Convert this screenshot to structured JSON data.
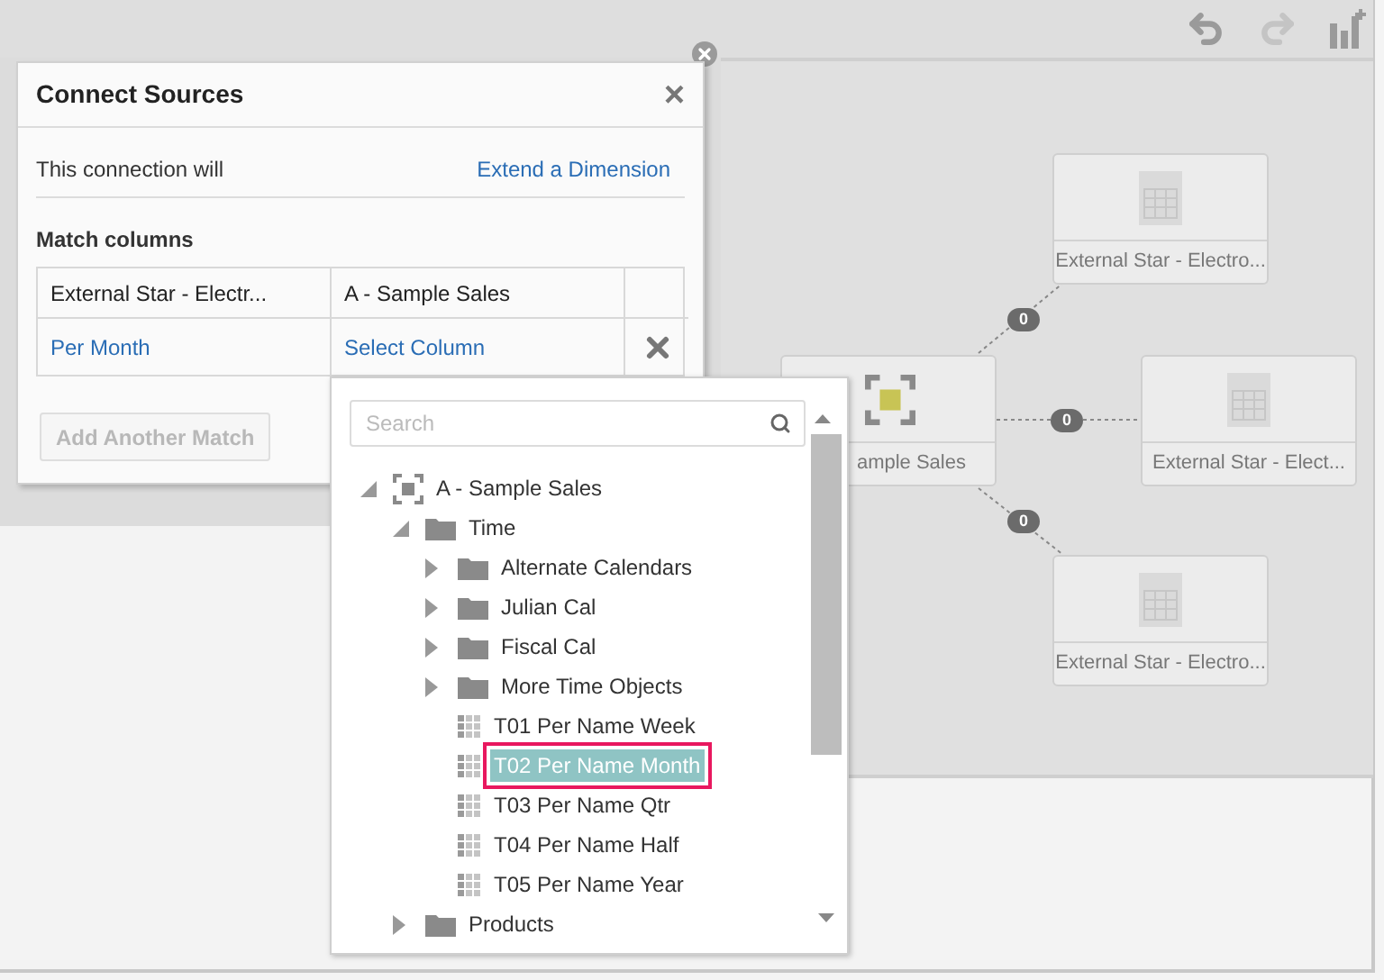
{
  "toolbar": {
    "buttons": [
      {
        "kind": "undo",
        "disabled": false
      },
      {
        "kind": "redo",
        "disabled": true
      },
      {
        "kind": "add-chart",
        "disabled": false
      }
    ]
  },
  "diagram": {
    "center": {
      "label": "ample Sales"
    },
    "nodes": [
      {
        "label": "External Star - Electro...",
        "badge": "0"
      },
      {
        "label": "External Star - Elect...",
        "badge": "0"
      },
      {
        "label": "External Star - Electro...",
        "badge": "0"
      }
    ]
  },
  "dialog": {
    "title": "Connect Sources",
    "close": "×",
    "connection_label": "This connection will",
    "connection_link": "Extend a Dimension",
    "match_heading": "Match columns",
    "table": {
      "columns": [
        "External Star - Electr...",
        "A - Sample Sales"
      ],
      "rows": [
        [
          "Per Month",
          "Select Column"
        ]
      ]
    },
    "add_button": {
      "label": "Add Another Match",
      "disabled": true
    }
  },
  "column_picker": {
    "search": {
      "placeholder": "Search"
    },
    "tree": [
      {
        "label": "A - Sample Sales",
        "kind": "dataset",
        "expanded": true,
        "selected": false,
        "children": [
          {
            "label": "Time",
            "kind": "folder",
            "expanded": true,
            "selected": false,
            "children": [
              {
                "label": "Alternate Calendars",
                "kind": "folder",
                "expanded": false,
                "selected": false
              },
              {
                "label": "Julian Cal",
                "kind": "folder",
                "expanded": false,
                "selected": false
              },
              {
                "label": "Fiscal Cal",
                "kind": "folder",
                "expanded": false,
                "selected": false
              },
              {
                "label": "More Time Objects",
                "kind": "folder",
                "expanded": false,
                "selected": false
              },
              {
                "label": "T01 Per Name Week",
                "kind": "column",
                "selected": false
              },
              {
                "label": "T02 Per Name Month",
                "kind": "column",
                "selected": true
              },
              {
                "label": "T03 Per Name Qtr",
                "kind": "column",
                "selected": false
              },
              {
                "label": "T04 Per Name Half",
                "kind": "column",
                "selected": false
              },
              {
                "label": "T05 Per Name Year",
                "kind": "column",
                "selected": false
              }
            ]
          },
          {
            "label": "Products",
            "kind": "folder",
            "expanded": false,
            "selected": false
          }
        ]
      }
    ]
  }
}
